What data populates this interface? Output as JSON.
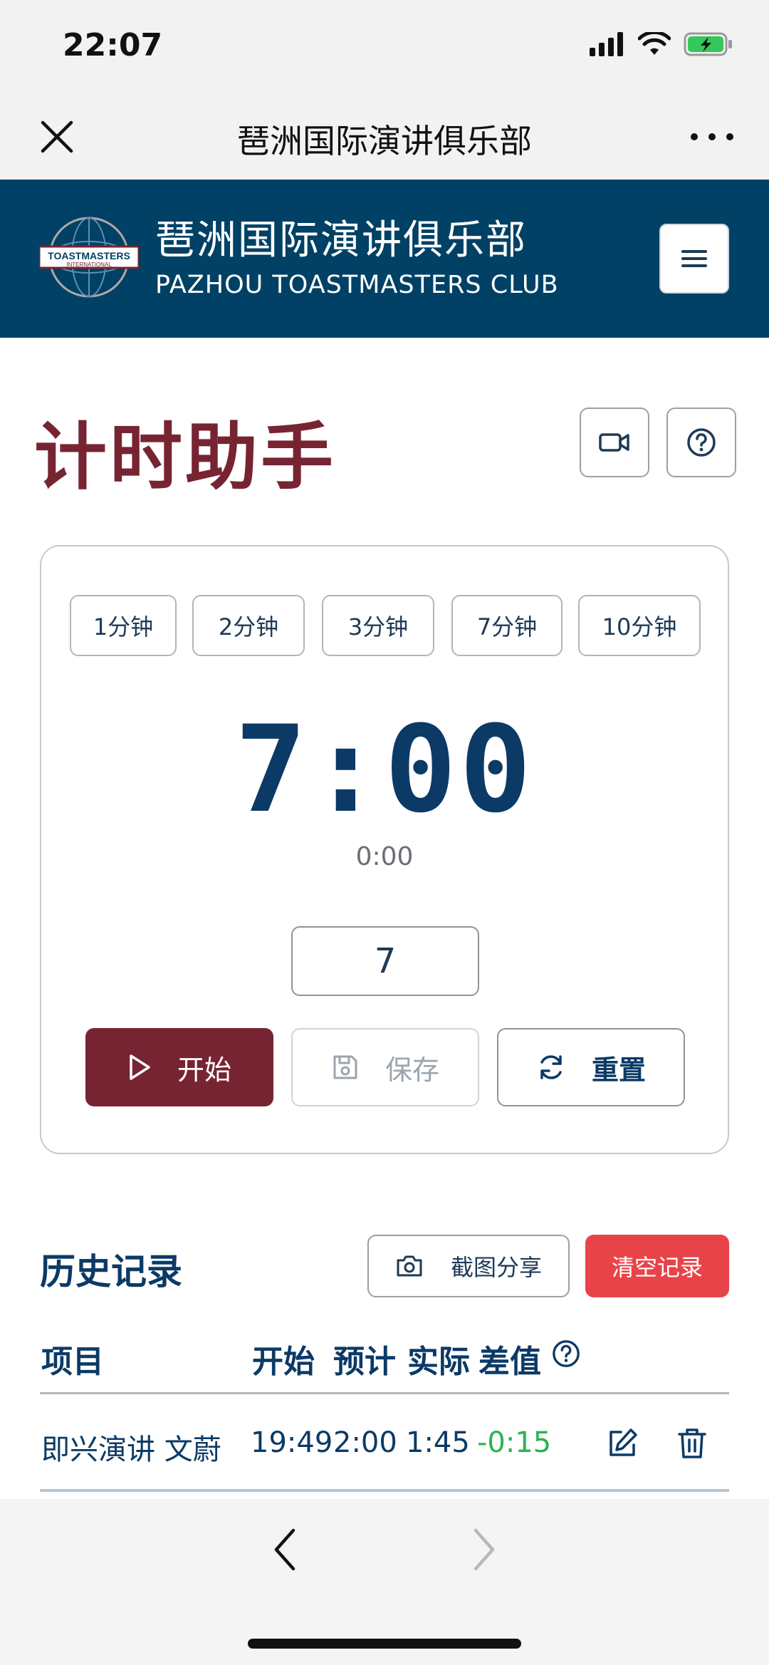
{
  "status_bar": {
    "time": "22:07"
  },
  "wechat_nav": {
    "title": "琶洲国际演讲俱乐部"
  },
  "site_header": {
    "logo_text": "TOASTMASTERS",
    "logo_subtext": "INTERNATIONAL",
    "name_cn": "琶洲国际演讲俱乐部",
    "name_en": "PAZHOU TOASTMASTERS CLUB"
  },
  "page": {
    "title": "计时助手"
  },
  "timer": {
    "presets": [
      "1分钟",
      "2分钟",
      "3分钟",
      "7分钟",
      "10分钟"
    ],
    "display": "7:00",
    "elapsed": "0:00",
    "minutes_value": "7",
    "start_label": "开始",
    "save_label": "保存",
    "reset_label": "重置"
  },
  "history": {
    "title": "历史记录",
    "share_label": "截图分享",
    "clear_label": "清空记录",
    "columns": [
      "项目",
      "开始",
      "预计",
      "实际",
      "差值"
    ],
    "rows": [
      {
        "item": "即兴演讲 文蔚",
        "start": "19:49",
        "planned": "2:00",
        "actual": "1:45",
        "diff": "-0:15"
      }
    ]
  },
  "colors": {
    "brand_blue": "#004165",
    "brand_maroon": "#772432",
    "danger": "#e9434a",
    "positive": "#2bb34f"
  }
}
